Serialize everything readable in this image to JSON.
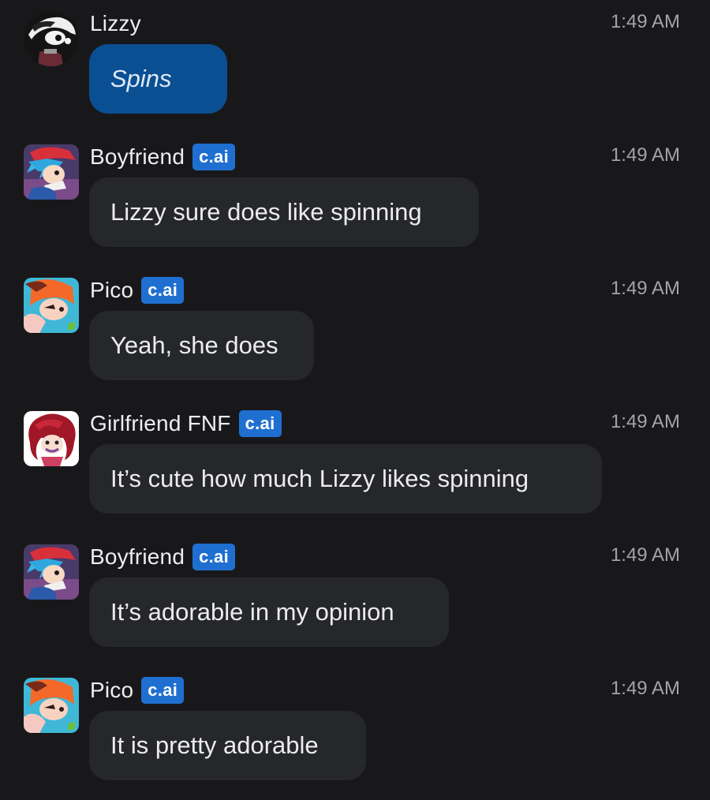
{
  "messages": [
    {
      "author": "Lizzy",
      "badge": null,
      "time": "1:49 AM",
      "text": "Spins",
      "avatar": "lizzy-avatar-icon",
      "is_user": true
    },
    {
      "author": "Boyfriend",
      "badge": "c.ai",
      "time": "1:49 AM",
      "text": "Lizzy sure does like spinning",
      "avatar": "boyfriend-avatar-icon",
      "is_user": false
    },
    {
      "author": "Pico",
      "badge": "c.ai",
      "time": "1:49 AM",
      "text": "Yeah, she does",
      "avatar": "pico-avatar-icon",
      "is_user": false
    },
    {
      "author": "Girlfriend FNF",
      "badge": "c.ai",
      "time": "1:49 AM",
      "text": "It’s cute how much Lizzy likes spinning",
      "avatar": "girlfriend-avatar-icon",
      "is_user": false
    },
    {
      "author": "Boyfriend",
      "badge": "c.ai",
      "time": "1:49 AM",
      "text": "It’s adorable in my opinion",
      "avatar": "boyfriend-avatar-icon",
      "is_user": false
    },
    {
      "author": "Pico",
      "badge": "c.ai",
      "time": "1:49 AM",
      "text": "It is pretty adorable",
      "avatar": "pico-avatar-icon",
      "is_user": false
    }
  ],
  "colors": {
    "background": "#18181b",
    "bubble": "#26272b",
    "user_bubble": "#0b4f93",
    "badge": "#1f6fd0",
    "timestamp": "#a3a3a8"
  }
}
